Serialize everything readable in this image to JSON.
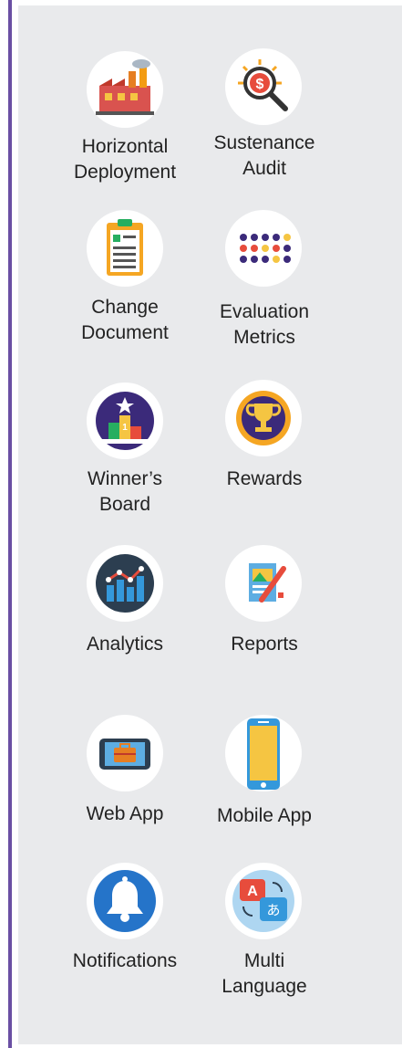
{
  "panel": {
    "items": [
      {
        "label_line1": "Horizontal",
        "label_line2": "Deployment",
        "icon": "factory-icon"
      },
      {
        "label_line1": "Sustenance",
        "label_line2": "Audit",
        "icon": "dollar-search-icon"
      },
      {
        "label_line1": "Change",
        "label_line2": "Document",
        "icon": "clipboard-document-icon"
      },
      {
        "label_line1": "Evaluation",
        "label_line2": "Metrics",
        "icon": "dot-grid-icon"
      },
      {
        "label_line1": "Winner’s",
        "label_line2": "Board",
        "icon": "podium-icon"
      },
      {
        "label_line1": "Rewards",
        "label_line2": "",
        "icon": "trophy-icon"
      },
      {
        "label_line1": "Analytics",
        "label_line2": "",
        "icon": "bar-line-chart-icon"
      },
      {
        "label_line1": "Reports",
        "label_line2": "",
        "icon": "report-pencil-icon"
      },
      {
        "label_line1": "Web App",
        "label_line2": "",
        "icon": "tablet-briefcase-icon"
      },
      {
        "label_line1": "Mobile App",
        "label_line2": "",
        "icon": "smartphone-icon"
      },
      {
        "label_line1": "Notifications",
        "label_line2": "",
        "icon": "bell-icon"
      },
      {
        "label_line1": "Multi",
        "label_line2": "Language",
        "icon": "translate-icon"
      }
    ]
  },
  "colors": {
    "accent_bar": "#6a4fa3",
    "panel_bg": "#e9eaec",
    "icon_bg": "#ffffff",
    "text": "#222222"
  }
}
